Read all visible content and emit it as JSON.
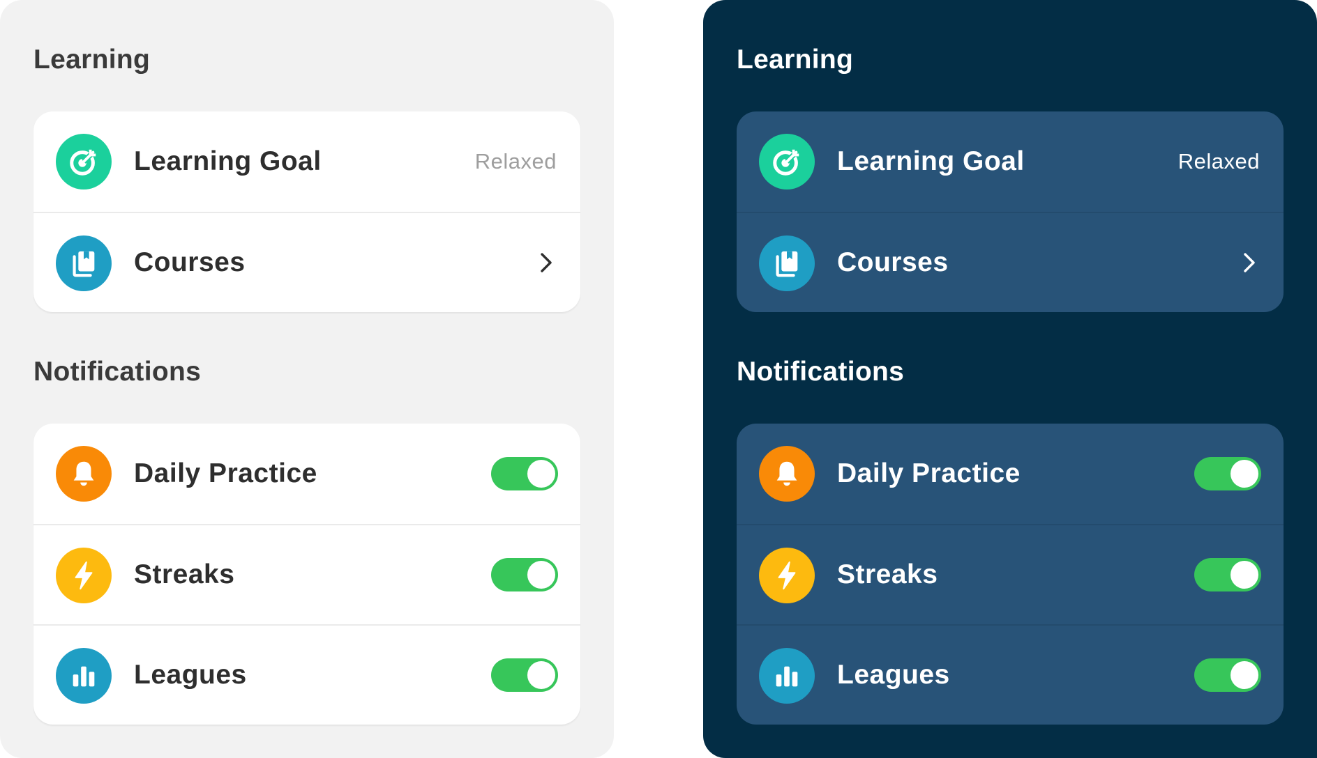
{
  "colors": {
    "light_background": "#f2f2f2",
    "dark_background": "#032d45",
    "dark_card": "#285378",
    "goal_icon": "#1bd09c",
    "courses_icon": "#1f9ec4",
    "daily_practice_icon": "#f98a07",
    "streaks_icon": "#fdba0f",
    "leagues_icon": "#1f9ec4",
    "toggle_on": "#37c65a"
  },
  "themes": {
    "light": {
      "learning": {
        "title": "Learning",
        "items": [
          {
            "label": "Learning Goal",
            "value": "Relaxed",
            "icon": "target-icon"
          },
          {
            "label": "Courses",
            "icon": "book-icon",
            "action": "chevron-right-icon"
          }
        ]
      },
      "notifications": {
        "title": "Notifications",
        "items": [
          {
            "label": "Daily Practice",
            "icon": "bell-icon",
            "toggle": true
          },
          {
            "label": "Streaks",
            "icon": "lightning-icon",
            "toggle": true
          },
          {
            "label": "Leagues",
            "icon": "bar-chart-icon",
            "toggle": true
          }
        ]
      }
    },
    "dark": {
      "learning": {
        "title": "Learning",
        "items": [
          {
            "label": "Learning Goal",
            "value": "Relaxed",
            "icon": "target-icon"
          },
          {
            "label": "Courses",
            "icon": "book-icon",
            "action": "chevron-right-icon"
          }
        ]
      },
      "notifications": {
        "title": "Notifications",
        "items": [
          {
            "label": "Daily Practice",
            "icon": "bell-icon",
            "toggle": true
          },
          {
            "label": "Streaks",
            "icon": "lightning-icon",
            "toggle": true
          },
          {
            "label": "Leagues",
            "icon": "bar-chart-icon",
            "toggle": true
          }
        ]
      }
    }
  }
}
